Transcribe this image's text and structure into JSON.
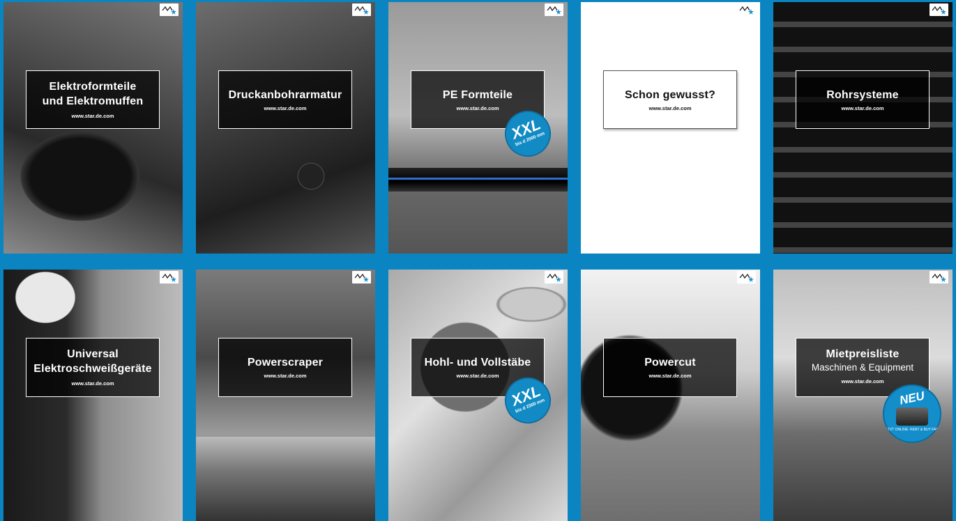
{
  "logo": {
    "icon": "star-logo-icon",
    "brand_color": "#1a8fcf"
  },
  "colors": {
    "background": "#0a85c2",
    "badge": "#128bc5"
  },
  "cards": [
    {
      "title": "Elektroformteile",
      "title2": "und Elektromuffen",
      "url": "www.star.de.com"
    },
    {
      "title": "Druckanbohrarmatur",
      "url": "www.star.de.com"
    },
    {
      "title": "PE Formteile",
      "url": "www.star.de.com",
      "badge": {
        "big": "XXL",
        "small": "bis d 2000 mm"
      }
    },
    {
      "title": "Schon gewusst?",
      "url": "www.star.de.com"
    },
    {
      "title": "Rohrsysteme",
      "url": "www.star.de.com"
    },
    {
      "title": "Universal",
      "title2": "Elektroschweißgeräte",
      "url": "www.star.de.com"
    },
    {
      "title": "Powerscraper",
      "url": "www.star.de.com"
    },
    {
      "title": "Hohl- und Vollstäbe",
      "url": "www.star.de.com",
      "badge": {
        "big": "XXL",
        "small": "bis d 2300 mm"
      }
    },
    {
      "title": "Powercut",
      "url": "www.star.de.com"
    },
    {
      "title": "Mietpreisliste",
      "subtitle": "Maschinen & Equipment",
      "url": "www.star.de.com",
      "badge": {
        "big": "NEU",
        "small": "JETZT ONLINE: RENT & BUY FAST"
      }
    }
  ]
}
